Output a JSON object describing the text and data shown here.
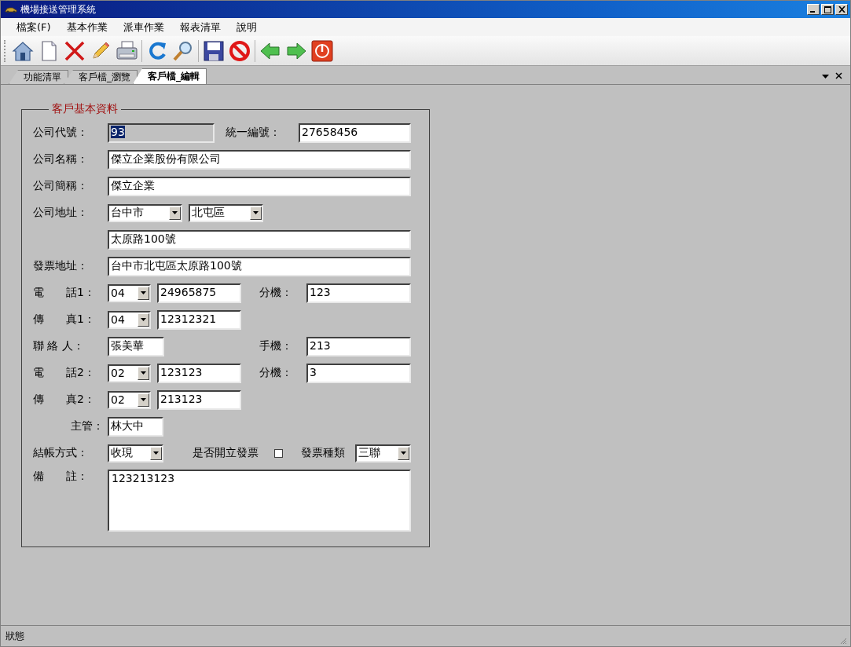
{
  "window": {
    "title": "機場接送管理系統"
  },
  "menu": [
    "檔案(F)",
    "基本作業",
    "派車作業",
    "報表清單",
    "說明"
  ],
  "tabs": [
    {
      "label": "功能清單",
      "selected": false
    },
    {
      "label": "客戶檔_瀏覽",
      "selected": false
    },
    {
      "label": "客戶檔_編輯",
      "selected": true
    }
  ],
  "form": {
    "legend": "客戶基本資料",
    "rows": [
      {
        "label": "公司代號：",
        "items": [
          {
            "kind": "input",
            "value": "93",
            "disabled": true,
            "text_selected": true
          },
          {
            "kind": "label",
            "text": "統一編號："
          },
          {
            "kind": "input",
            "value": "27658456",
            "disabled": false,
            "text_selected": false
          }
        ]
      },
      {
        "label": "公司名稱：",
        "items": [
          {
            "kind": "input",
            "value": "傑立企業股份有限公司",
            "disabled": false,
            "text_selected": false
          }
        ]
      },
      {
        "label": "公司簡稱：",
        "items": [
          {
            "kind": "input",
            "value": "傑立企業",
            "disabled": false,
            "text_selected": false
          }
        ]
      },
      {
        "label": "公司地址：",
        "items": [
          {
            "kind": "select",
            "value": "台中市"
          },
          {
            "kind": "select",
            "value": "北屯區"
          }
        ]
      },
      {
        "items": [
          {
            "kind": "input",
            "value": "太原路100號",
            "disabled": false,
            "text_selected": false
          }
        ]
      },
      {
        "label": "發票地址：",
        "items": [
          {
            "kind": "input",
            "value": "台中市北屯區太原路100號",
            "disabled": false,
            "text_selected": false
          }
        ]
      },
      {
        "label": "電　　話1：",
        "items": [
          {
            "kind": "select",
            "value": "04"
          },
          {
            "kind": "input",
            "value": "24965875",
            "disabled": false,
            "text_selected": false
          },
          {
            "kind": "label",
            "text": "分機："
          },
          {
            "kind": "input",
            "value": "123",
            "disabled": false,
            "text_selected": false
          }
        ]
      },
      {
        "label": "傳　　真1：",
        "items": [
          {
            "kind": "select",
            "value": "04"
          },
          {
            "kind": "input",
            "value": "12312321",
            "disabled": false,
            "text_selected": false
          }
        ]
      },
      {
        "label": "聯 絡 人：",
        "items": [
          {
            "kind": "input",
            "value": "張美華",
            "disabled": false,
            "text_selected": false
          },
          {
            "kind": "label",
            "text": "手機："
          },
          {
            "kind": "input",
            "value": "213",
            "disabled": false,
            "text_selected": false
          }
        ]
      },
      {
        "label": "電　　話2：",
        "items": [
          {
            "kind": "select",
            "value": "02"
          },
          {
            "kind": "input",
            "value": "123123",
            "disabled": false,
            "text_selected": false
          },
          {
            "kind": "label",
            "text": "分機："
          },
          {
            "kind": "input",
            "value": "3",
            "disabled": false,
            "text_selected": false
          }
        ]
      },
      {
        "label": "傳　　真2：",
        "items": [
          {
            "kind": "select",
            "value": "02"
          },
          {
            "kind": "input",
            "value": "213123",
            "disabled": false,
            "text_selected": false
          }
        ]
      },
      {
        "label": "主管：",
        "items": [
          {
            "kind": "input",
            "value": "林大中",
            "disabled": false,
            "text_selected": false
          }
        ]
      },
      {
        "label": "結帳方式：",
        "items": [
          {
            "kind": "select",
            "value": "收現"
          },
          {
            "kind": "label",
            "text": "是否開立發票"
          },
          {
            "kind": "checkbox",
            "checked": false
          },
          {
            "kind": "label",
            "text": "發票種類"
          },
          {
            "kind": "select",
            "value": "三聯"
          }
        ]
      },
      {
        "label": "備　　註：",
        "items": [
          {
            "kind": "textarea",
            "value": "123213123"
          }
        ]
      }
    ]
  },
  "status_bar": "狀態"
}
